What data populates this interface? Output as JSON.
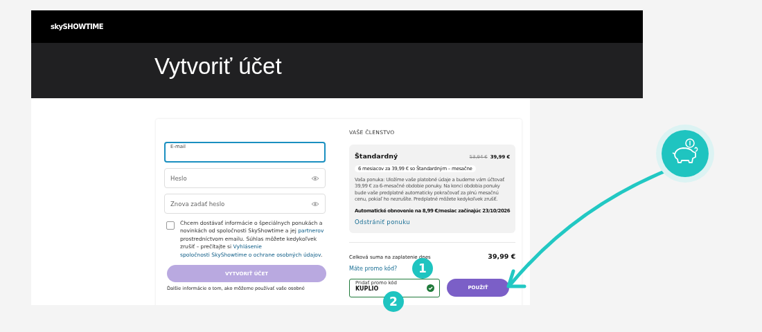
{
  "header": {
    "logo": "skySHOWTIME"
  },
  "title": "Vytvoriť účet",
  "form": {
    "fields": [
      {
        "label": "E-mail",
        "focused": true,
        "eye": false
      },
      {
        "placeholder": "Heslo",
        "focused": false,
        "eye": true
      },
      {
        "placeholder": "Znova zadať heslo",
        "focused": false,
        "eye": true
      }
    ],
    "consent": {
      "checked": false,
      "parts": [
        {
          "kind": "text",
          "text": "Chcem dostávať informácie o špeciálnych ponukách a novinkách od spoločnosti SkyShowtime a jej "
        },
        {
          "kind": "link",
          "text": "partnerov"
        },
        {
          "kind": "text",
          "text": " prostredníctvom emailu. Súhlas môžete kedykoľvek zrušiť – prečítajte si "
        },
        {
          "kind": "link",
          "text": "Vyhlásenie"
        },
        {
          "kind": "link",
          "text": "spoločnosti SkyShowtime o ochrane osobných"
        },
        {
          "kind": "link",
          "text": "údajov"
        },
        {
          "kind": "text",
          "text": "."
        }
      ]
    },
    "submit": {
      "label": "VYTVORIŤ ÚČET",
      "disabled": true
    },
    "footnote": "Ďalšie informácie o tom, ako môžeme používať vaše osobné"
  },
  "membership": {
    "heading": "VAŠE ČLENSTVO",
    "plan": {
      "name": "Štandardný",
      "old_price": "53,94 €",
      "price": "39,99 €",
      "pill": "6 mesiacov za 39,99 € so Štandardným – mesačne",
      "description": "Vaša ponuka: Uložíme vaše platobné údaje a budeme vám účtovať 39,99 € za 6-mesačné obdobie ponuky. Na konci obdobia ponuky bude vaše predplatné automaticky pokračovať za plnú mesačnú cenu, pokiaľ ho nezrušíte. Predplatné môžete kedykoľvek zrušiť.",
      "renewal": "Automatické obnovenie na 8,99 €/mesiac začínajúc 23/10/2026",
      "remove": "Odstrániť ponuku"
    },
    "total_label": "Celková suma na zaplatenie dnes",
    "total": "39,99 €",
    "promo_link": "Máte promo kód?",
    "promo": {
      "label": "Pridať promo kód",
      "value": "KUPLIO",
      "valid": true
    },
    "apply": "POUŽIŤ"
  },
  "annotations": [
    {
      "number": "1"
    },
    {
      "number": "2"
    }
  ]
}
